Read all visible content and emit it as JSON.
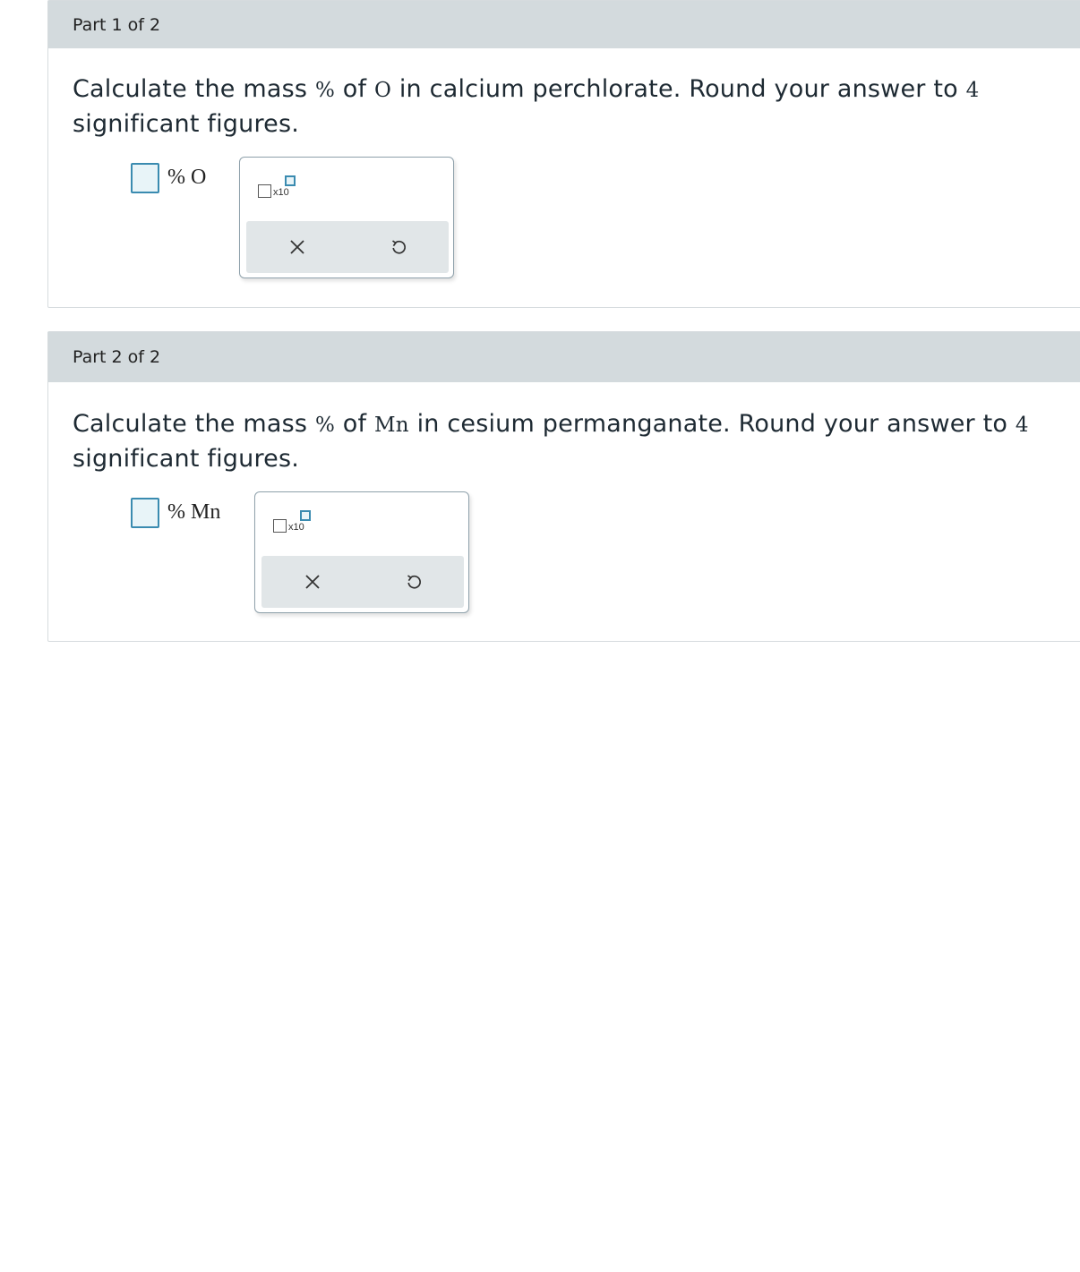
{
  "parts": [
    {
      "header": "Part 1 of 2",
      "question": {
        "pre": "Calculate the mass ",
        "percent": "%",
        "of": " of ",
        "element": "O",
        "post": " in calcium perchlorate. Round your answer to ",
        "num": "4",
        "line2": "significant figures."
      },
      "unit": "% O",
      "answer_value": ""
    },
    {
      "header": "Part 2 of 2",
      "question": {
        "pre": "Calculate the mass ",
        "percent": "%",
        "of": " of ",
        "element": "Mn",
        "post": " in cesium permanganate. Round your answer to ",
        "num": "4",
        "line2": "significant figures."
      },
      "unit": "% Mn",
      "answer_value": ""
    }
  ],
  "palette": {
    "sci_label": "x10",
    "clear_icon": "close-icon",
    "undo_icon": "undo-icon"
  },
  "colors": {
    "header_bg": "#d3dadd",
    "accent": "#3a8bb0",
    "input_bg": "#e8f4f8",
    "action_bar": "#e1e6e8"
  }
}
